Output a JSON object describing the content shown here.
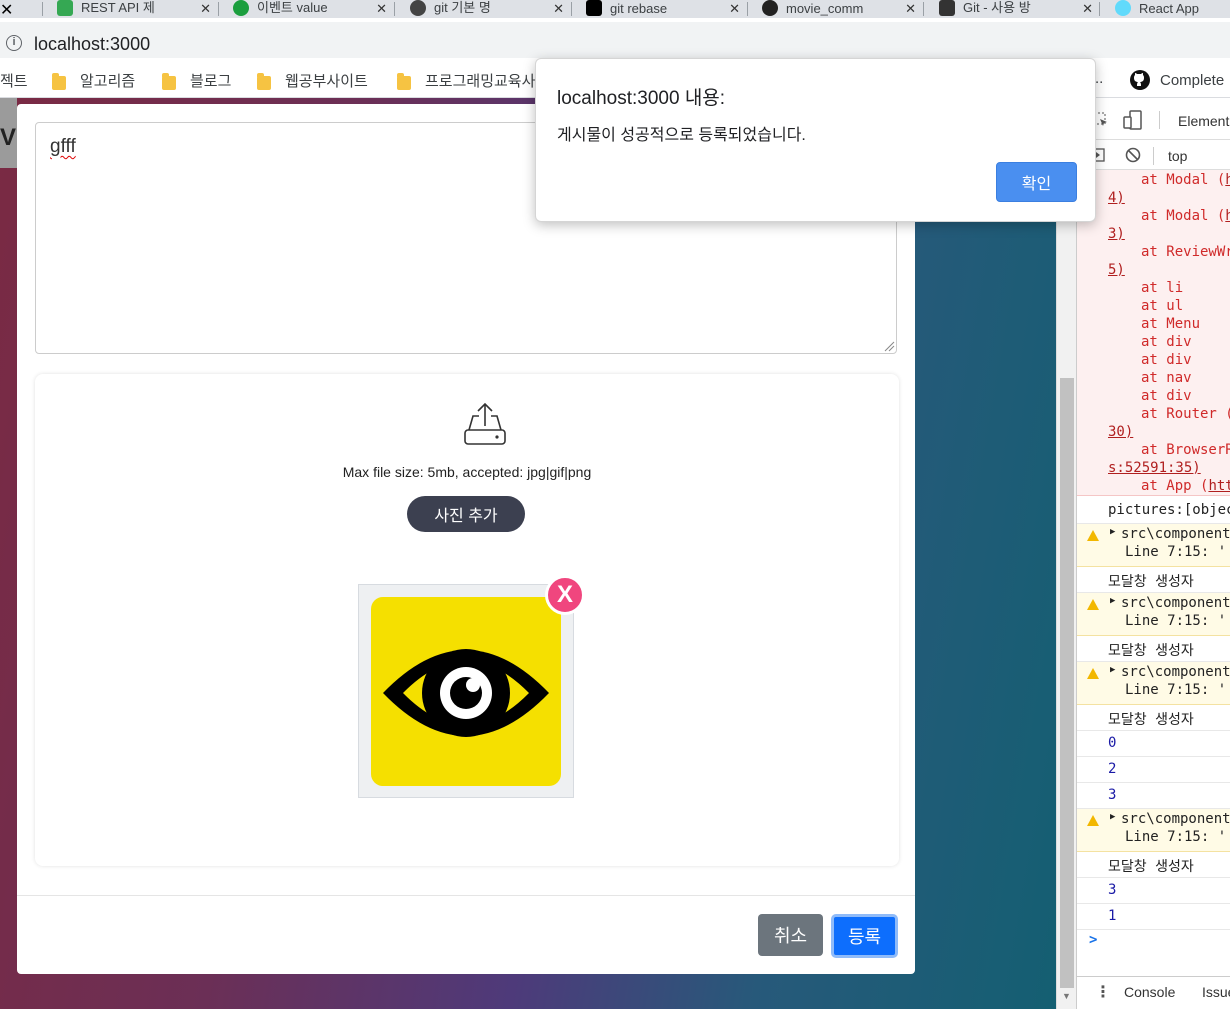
{
  "browser": {
    "tabs": [
      {
        "label": "REST API 제",
        "favicon_color": "#35a853"
      },
      {
        "label": "이벤트 value",
        "favicon_color": "#1b9e3e"
      },
      {
        "label": "git 기본 명",
        "favicon_color": "#444444"
      },
      {
        "label": "git rebase",
        "favicon_color": "#000000"
      },
      {
        "label": "movie_comm",
        "favicon_color": "#222222"
      },
      {
        "label": "Git - 사용 방",
        "favicon_color": "#333333"
      },
      {
        "label": "React App",
        "favicon_color": "#61dafb"
      }
    ],
    "url": "localhost:3000",
    "bookmarks": [
      {
        "label": "젝트"
      },
      {
        "label": "알고리즘"
      },
      {
        "label": "블로그"
      },
      {
        "label": "웹공부사이트"
      },
      {
        "label": "프로그래밍교육사"
      },
      {
        "label": "Complete"
      }
    ]
  },
  "modal": {
    "textarea_value": "gfff",
    "file_info": "Max file size: 5mb, accepted: jpg|gif|png",
    "add_photo_label": "사진 추가",
    "remove_label": "X",
    "cancel_label": "취소",
    "submit_label": "등록",
    "left_edge_char": "V"
  },
  "alert": {
    "title": "localhost:3000 내용:",
    "message": "게시물이 성공적으로 등록되었습니다.",
    "ok_label": "확인"
  },
  "devtools": {
    "tab_label": "Element",
    "context_label": "top",
    "error_lines": [
      {
        "text": "at Modal (",
        "link": "h"
      },
      {
        "text": "4)",
        "link": ""
      },
      {
        "text": "at Modal (",
        "link": "h"
      },
      {
        "text": "3)",
        "link": ""
      },
      {
        "text": "at ReviewWr",
        "link": ""
      },
      {
        "text": "5)",
        "link": ""
      },
      {
        "text": "at li",
        "link": ""
      },
      {
        "text": "at ul",
        "link": ""
      },
      {
        "text": "at Menu",
        "link": ""
      },
      {
        "text": "at div",
        "link": ""
      },
      {
        "text": "at div",
        "link": ""
      },
      {
        "text": "at nav",
        "link": ""
      },
      {
        "text": "at div",
        "link": ""
      },
      {
        "text": "at Router (",
        "link": ""
      },
      {
        "text": "30)",
        "link": ""
      },
      {
        "text": "at BrowserR",
        "link": ""
      },
      {
        "text": "s:52591:35)",
        "link": ""
      },
      {
        "text": "at App (",
        "link": "htt"
      }
    ],
    "log_pictures": "pictures:[objec",
    "warn_src": "src\\component",
    "warn_line": "Line 7:15:  '",
    "log_modal": "모달창 생성자",
    "numbers": [
      "0",
      "2",
      "3",
      "3",
      "1"
    ],
    "prompt": ">",
    "bottom_tabs": [
      "Console",
      "Issue"
    ]
  }
}
